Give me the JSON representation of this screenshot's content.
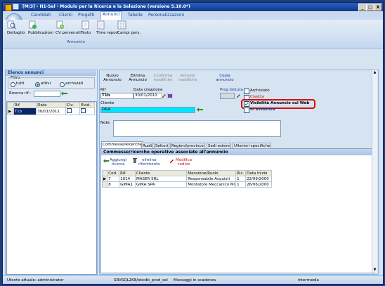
{
  "window": {
    "title": "[M/3] - H1-Sel - Modulo per la Ricerca e la Selezione (versione 5.10.0*)",
    "minimize": "_",
    "maximize": "□",
    "close": "X"
  },
  "ribbon": {
    "tabs": [
      "Candidati",
      "Clienti",
      "Progetti",
      "Annunci",
      "Tabelle",
      "Personalizzazioni"
    ],
    "active_tab": "Annunci",
    "buttons": [
      "Dettaglio",
      "Pubblicazioni",
      "CV pervenuti",
      "Testo",
      "Time report",
      "Campi pers."
    ],
    "group_label": "Annuncio"
  },
  "left": {
    "title": "Elenco annunci",
    "filter_label": "Filtro",
    "filter_options": [
      "tutti",
      "attivi",
      "archiviati"
    ],
    "filter_selected": "attivi",
    "search_label": "Ricerca rif.:",
    "search_value": "",
    "columns": [
      "Rif",
      "Data",
      "Civ.",
      "Evid."
    ],
    "rows": [
      {
        "rif": "T1b",
        "data": "30/01/2011"
      }
    ]
  },
  "toolbar": {
    "nuovo": "Nuovo\nAnnuncio",
    "elimina": "Elimina\nAnnuncio",
    "conferma": "Conferma\nmodifiche",
    "annulla": "Annulla\nmodifiche",
    "copia": "Copia\nannuncio"
  },
  "form": {
    "rif_label": "Rif",
    "rif_value": "T1b",
    "data_label": "Data creazione",
    "data_value": "30/01/2011",
    "prog_label": "Prog.fattura",
    "cliente_label": "Cliente",
    "cliente_value": "D&A",
    "note_label": "Note",
    "note_value": "",
    "archiviato_label": "Archiviato",
    "civetta_label": "Civetta",
    "visibilita_label": "Visibilità Annuncio sul Web",
    "evidenza_label": "In evidenza",
    "archiviato": false,
    "civetta": false,
    "visibilita": true,
    "evidenza": false
  },
  "subtabs": [
    "Commesse/Ricerche",
    "Ruoli",
    "Settori",
    "Regioni/province",
    "Sedi estere",
    "Ulteriori specifiche"
  ],
  "active_subtab": "Commesse/Ricerche",
  "commesse": {
    "title": "Commesse/ricerche operative associate all'annuncio",
    "add_label": "Aggiungi\nricerca",
    "delete_label": "elimina\nriferimento",
    "edit_label": "Modifica\ncodice",
    "columns": [
      "Cod.",
      "Rif.",
      "Cliente",
      "Mansione/Ruolo",
      "Ric.",
      "Data Inizio"
    ],
    "rows": [
      {
        "cod": "7",
        "rif": "1014",
        "cliente": "MASER SRL",
        "mansione": "Responsabile Acquisti",
        "ric": "1",
        "data": "22/09/2000"
      },
      {
        "cod": "8",
        "rif": "GIMA1",
        "cliente": "GIMA SPA",
        "mansione": "Montatore Meccanico Mi",
        "ric": "1",
        "data": "26/06/2000"
      }
    ]
  },
  "status": {
    "user": "Utente attuale: administrator",
    "server": "SRVSQL2K8/ebcdb_prod_sel",
    "messages": "Messaggi in scadenza",
    "mode": "intermedia"
  },
  "colors": {
    "accent": "#15428b",
    "cliente_bg": "#00e5ff",
    "highlight_border": "#e00000"
  }
}
